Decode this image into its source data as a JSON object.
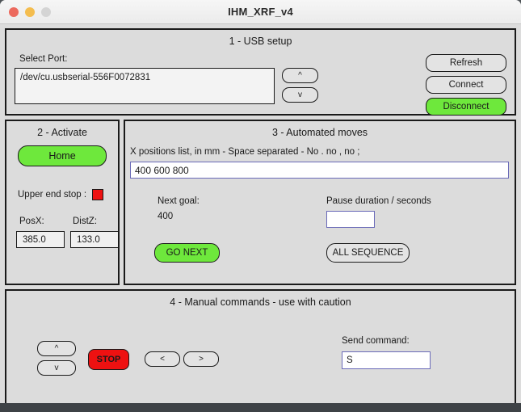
{
  "window": {
    "title": "IHM_XRF_v4",
    "controls": [
      {
        "name": "close",
        "glyph": ""
      },
      {
        "name": "minimize",
        "glyph": ""
      },
      {
        "name": "zoom",
        "glyph": ""
      }
    ]
  },
  "colors": {
    "panel_bg": "#dcdcdc",
    "panel_border": "#1a1a1a",
    "accent_green": "#6ee83c",
    "accent_red": "#ee1111",
    "input_focus_border": "#6a6ab8",
    "button_bg": "#e3e3e3",
    "titlebar_bg": "#f0f0f0",
    "bottom_bar": "#3e4246"
  },
  "section1": {
    "title": "1 - USB setup",
    "select_port_label": "Select Port:",
    "ports": [
      "/dev/cu.usbserial-556F0072831"
    ],
    "scroll_up_glyph": "^",
    "scroll_down_glyph": "v",
    "buttons": {
      "refresh": "Refresh",
      "connect": "Connect",
      "disconnect": "Disconnect"
    }
  },
  "section2": {
    "title": "2 - Activate",
    "home_button": "Home",
    "upper_end_stop_label": "Upper end stop :",
    "upper_end_stop_state": "triggered",
    "posx_label": "PosX:",
    "posx_value": "385.0",
    "distz_label": "DistZ:",
    "distz_value": "133.0"
  },
  "section3": {
    "title": "3 - Automated moves",
    "xpositions_label": "X positions list, in mm - Space separated - No . no , no ;",
    "xpositions_value": "400 600 800",
    "next_goal_label": "Next goal:",
    "next_goal_value": "400",
    "pause_label": "Pause duration / seconds",
    "pause_value": "",
    "pause_placeholder": "",
    "go_next_button": "GO NEXT",
    "all_sequence_button": "ALL SEQUENCE"
  },
  "section4": {
    "title": "4 - Manual commands - use with caution",
    "up_glyph": "^",
    "down_glyph": "v",
    "left_glyph": "<",
    "right_glyph": ">",
    "stop_button": "STOP",
    "send_command_label": "Send command:",
    "send_command_value": "S",
    "send_command_placeholder": ""
  }
}
